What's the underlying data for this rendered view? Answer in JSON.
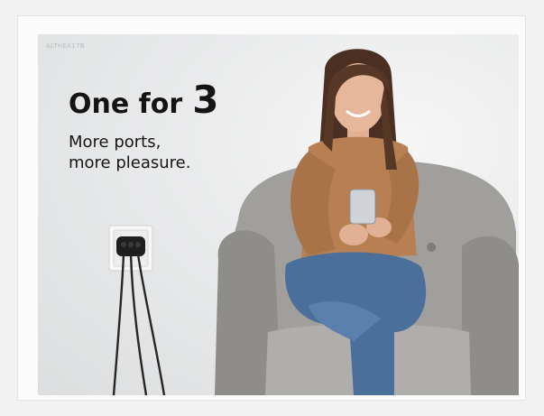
{
  "product": {
    "sku": "ALTHEA17B"
  },
  "headline": {
    "lead": "One for",
    "number": "3"
  },
  "tagline": {
    "line1": "More ports,",
    "line2": "more pleasure."
  },
  "colors": {
    "background": "#f1f1f1",
    "wall": "#e6e7e8",
    "headline_text": "#141414",
    "sweater": "#b77f52",
    "jeans": "#4a6f9b",
    "armchair": "#9a9896",
    "plug": "#1f1f1f"
  }
}
